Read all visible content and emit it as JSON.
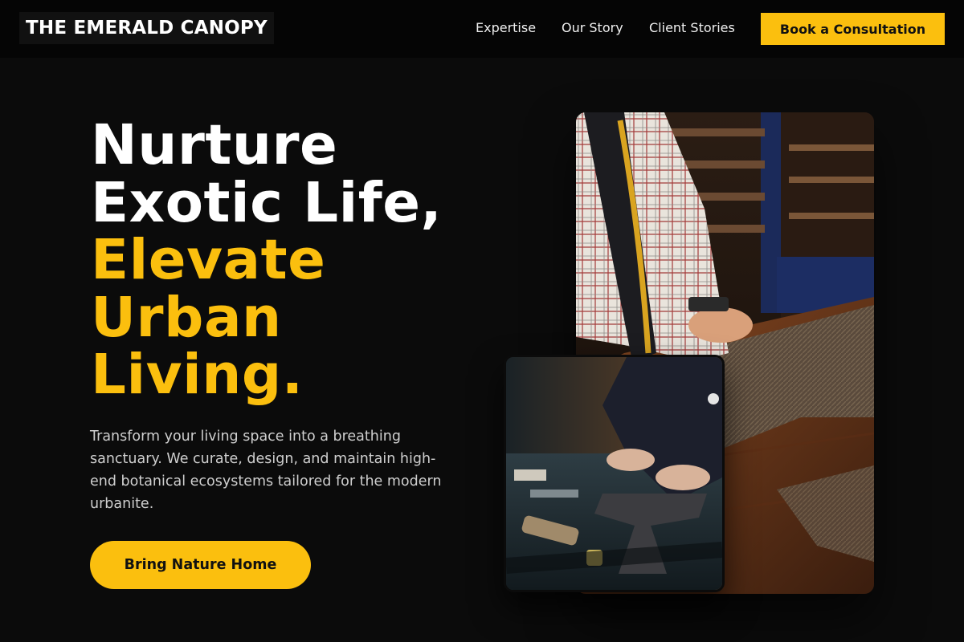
{
  "header": {
    "logo": "THE EMERALD CANOPY",
    "nav": [
      "Expertise",
      "Our Story",
      "Client Stories"
    ],
    "cta": "Book a Consultation"
  },
  "hero": {
    "headline_white": [
      "Nurture",
      "Exotic Life,"
    ],
    "headline_gold": [
      "Elevate",
      "Urban",
      "Living."
    ],
    "lead": "Transform your living space into a breathing sanctuary. We curate, design, and maintain high-end botanical ecosystems tailored for the modern urbanite.",
    "button": "Bring Nature Home"
  },
  "colors": {
    "accent": "#fbbf0e",
    "background": "#0b0b0b"
  }
}
